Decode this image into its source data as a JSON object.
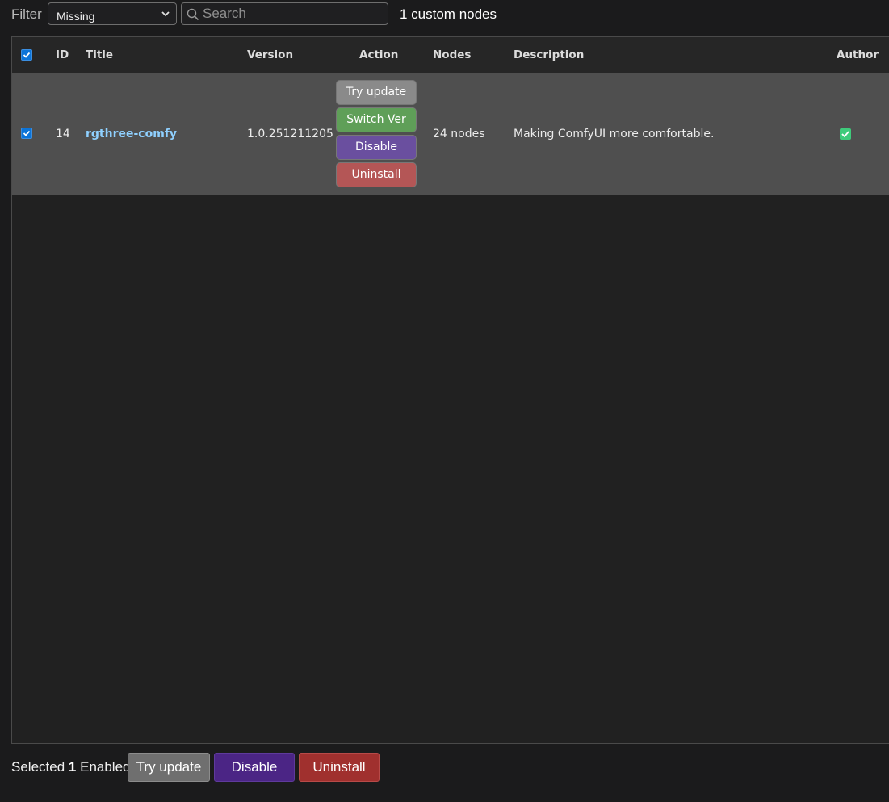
{
  "toolbar": {
    "filter_label": "Filter",
    "filter_selected": "Missing",
    "search_placeholder": "Search",
    "search_value": "",
    "count_label": "1 custom nodes"
  },
  "table": {
    "header_checkbox_checked": true,
    "columns": {
      "id": "ID",
      "title": "Title",
      "version": "Version",
      "action": "Action",
      "nodes": "Nodes",
      "description": "Description",
      "author": "Author"
    },
    "rows": [
      {
        "selected": true,
        "id": "14",
        "title": "rgthree-comfy",
        "version": "1.0.251211205",
        "nodes": "24 nodes",
        "description": "Making ComfyUI more comfortable.",
        "author_verified": true,
        "actions": {
          "try_update": "Try update",
          "switch_ver": "Switch Ver",
          "disable": "Disable",
          "uninstall": "Uninstall"
        }
      }
    ]
  },
  "footer": {
    "selected_prefix": "Selected",
    "selected_count": "1",
    "selected_suffix": "Enabled",
    "try_update": "Try update",
    "disable": "Disable",
    "uninstall": "Uninstall"
  },
  "colors": {
    "try_update": "#8a8a8a",
    "switch_ver": "#5f9f58",
    "disable": "#6a4f9f",
    "uninstall": "#b45656",
    "footer_try_update": "#6f6f6f",
    "footer_disable": "#4b2585",
    "footer_uninstall": "#a0302e",
    "link": "#8fd0ff",
    "author_check": "#3ecb7b"
  }
}
